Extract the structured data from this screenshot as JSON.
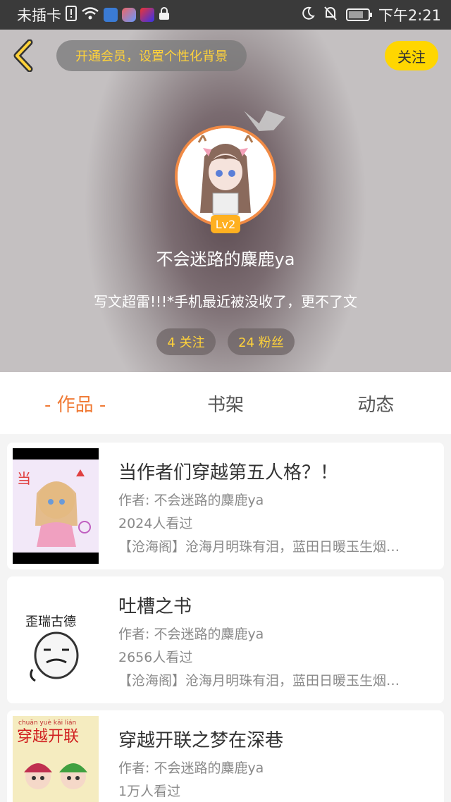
{
  "status_bar": {
    "carrier": "未插卡",
    "time": "下午2:21",
    "icons": [
      "sim-alert-icon",
      "wifi-icon",
      "baidu-icon",
      "app-icon",
      "app-icon",
      "lock-icon",
      "moon-icon",
      "mute-bell-icon",
      "battery-icon"
    ]
  },
  "header": {
    "vip_prompt": "开通会员，设置个性化背景",
    "follow_label": "关注",
    "level": "Lv2",
    "username": "不会迷路的麋鹿ya",
    "bio": "写文超雷!!!*手机最近被没收了，更不了文",
    "following": "4 关注",
    "followers": "24 粉丝"
  },
  "tabs": [
    {
      "label": "- 作品 -",
      "active": true
    },
    {
      "label": "书架",
      "active": false
    },
    {
      "label": "动态",
      "active": false
    }
  ],
  "works": [
    {
      "title": "当作者们穿越第五人格？！",
      "author": "作者: 不会迷路的麋鹿ya",
      "views": "2024人看过",
      "desc": "【沧海阁】沧海月明珠有泪，蓝田日暖玉生烟…",
      "cover_text": "当"
    },
    {
      "title": "吐槽之书",
      "author": "作者: 不会迷路的麋鹿ya",
      "views": "2656人看过",
      "desc": "【沧海阁】沧海月明珠有泪，蓝田日暖玉生烟…",
      "cover_text": "歪瑞古德"
    },
    {
      "title": "穿越开联之梦在深巷",
      "author": "作者: 不会迷路的麋鹿ya",
      "views": "1万人看过",
      "desc": "",
      "cover_text": "穿越开联",
      "cover_pinyin": "chuān yuè kāi lián"
    }
  ],
  "colors": {
    "accent": "#f07a35",
    "vip_text": "#ffd23a",
    "follow_bg": "#ffd600",
    "avatar_border": "#f08a45",
    "level_bg": "#ffb020"
  }
}
